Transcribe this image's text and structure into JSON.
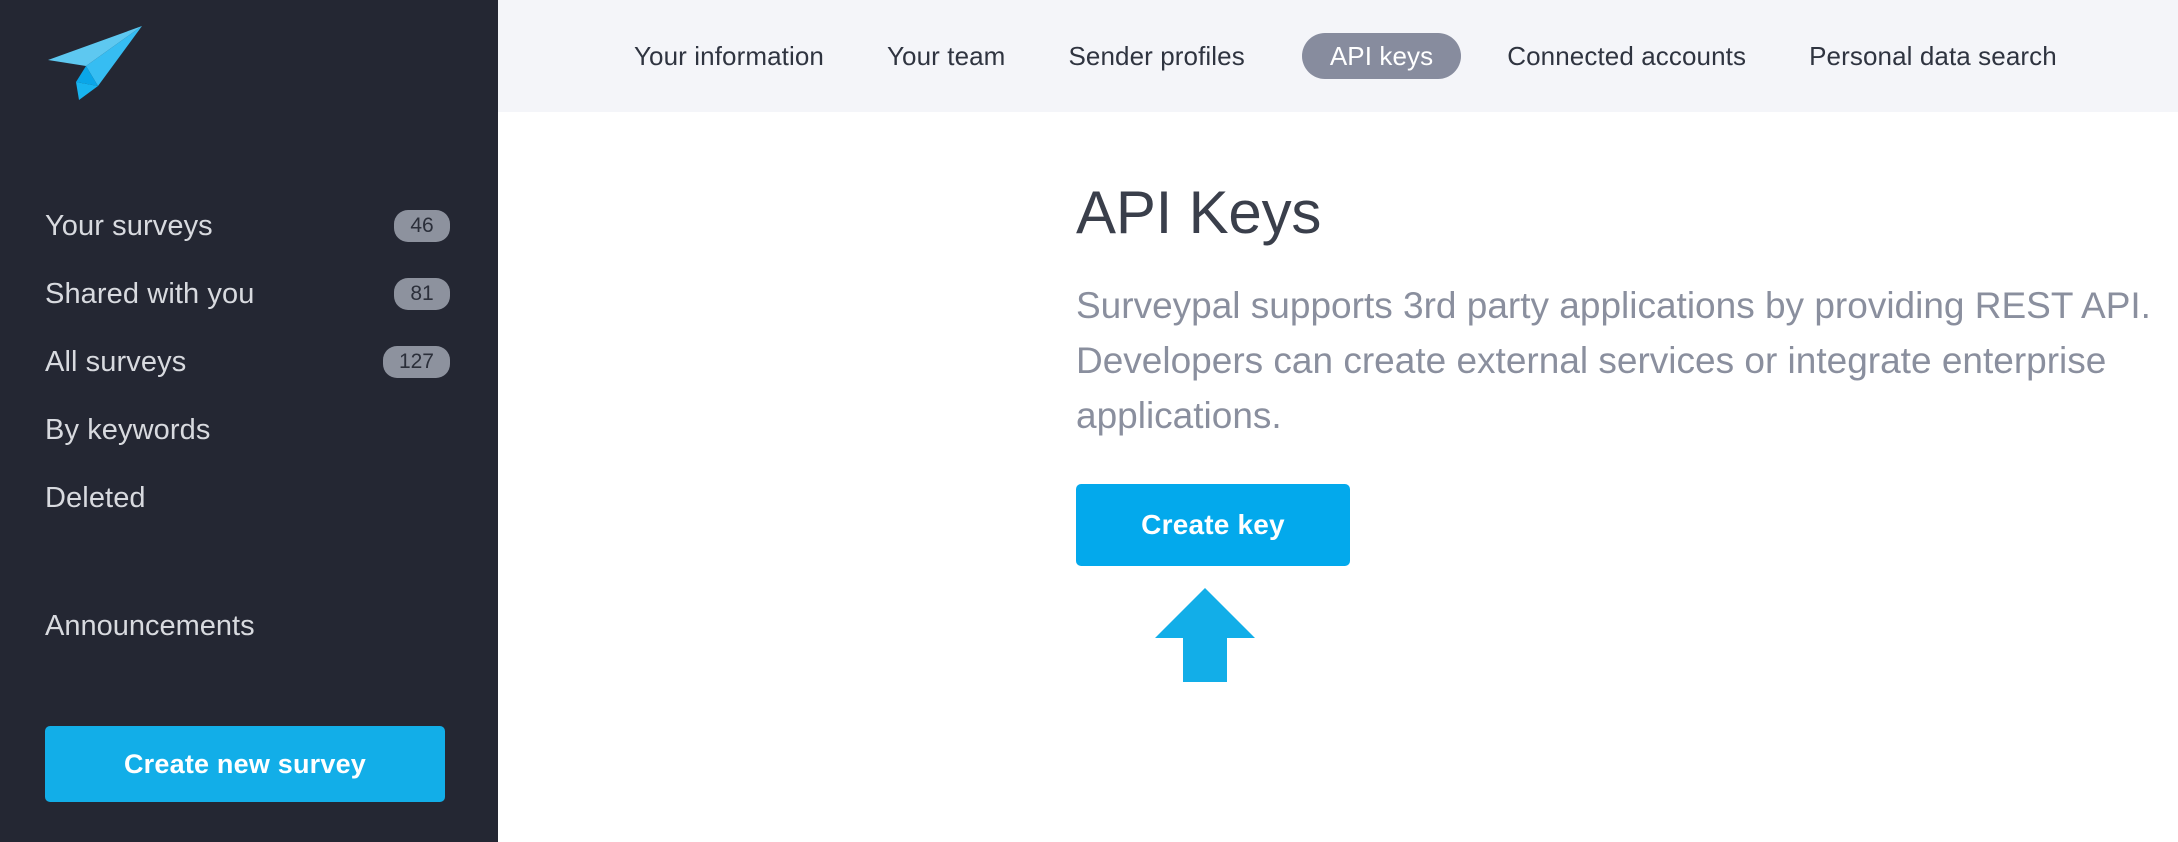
{
  "sidebar": {
    "logo": {
      "icon": "paper-plane-logo",
      "colors": {
        "light": "#5ec8f0",
        "mid": "#36bdf2",
        "dark": "#0aa6e8"
      }
    },
    "items": [
      {
        "label": "Your surveys",
        "badge": "46"
      },
      {
        "label": "Shared with you",
        "badge": "81"
      },
      {
        "label": "All surveys",
        "badge": "127"
      },
      {
        "label": "By keywords",
        "badge": null
      },
      {
        "label": "Deleted",
        "badge": null
      }
    ],
    "announcements_label": "Announcements",
    "create_survey_label": "Create new survey"
  },
  "topnav": {
    "tabs": [
      {
        "label": "Your information",
        "active": false
      },
      {
        "label": "Your team",
        "active": false
      },
      {
        "label": "Sender profiles",
        "active": false
      },
      {
        "label": "API keys",
        "active": true
      },
      {
        "label": "Connected accounts",
        "active": false
      },
      {
        "label": "Personal data search",
        "active": false
      }
    ]
  },
  "main": {
    "title": "API Keys",
    "description": "Surveypal supports 3rd party applications by providing REST API. Developers can create external services or integrate enterprise applications.",
    "create_key_label": "Create key",
    "annotation": {
      "icon": "up-arrow-annotation",
      "points_to": "create-key-button"
    }
  },
  "colors": {
    "sidebar_bg": "#242733",
    "topnav_bg": "#f4f5f9",
    "content_bg": "#ffffff",
    "accent_blue": "#03a9ec",
    "sidebar_button_blue": "#12aee8",
    "active_tab_gray": "#878c9e",
    "badge_gray": "#8d929e",
    "annotation_blue": "#12aee8",
    "title_text": "#3a3f4b",
    "description_text": "#8a8f9e",
    "sidebar_text": "#d8dadf",
    "tab_text": "#2f3440"
  }
}
